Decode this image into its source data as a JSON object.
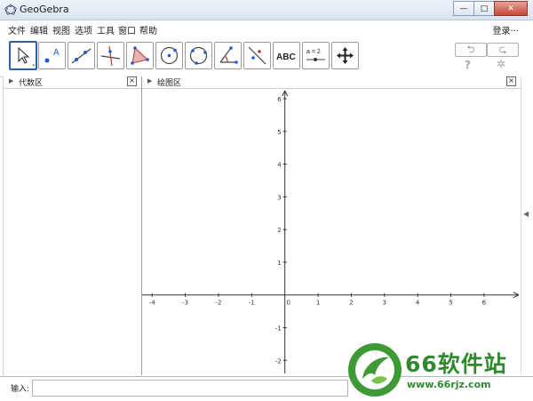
{
  "window": {
    "title": "GeoGebra",
    "minimize": "—",
    "maximize": "□",
    "close": "✕"
  },
  "menu": {
    "items": [
      "文件",
      "编辑",
      "视图",
      "选项",
      "工具",
      "窗口",
      "帮助"
    ],
    "login": "登录···"
  },
  "toolbar": {
    "tools": [
      {
        "name": "move-tool",
        "icon": "arrow-cursor-icon"
      },
      {
        "name": "point-tool",
        "icon": "point-A-icon",
        "label": "A"
      },
      {
        "name": "line-tool",
        "icon": "line-through-points-icon"
      },
      {
        "name": "perpendicular-tool",
        "icon": "perpendicular-line-icon"
      },
      {
        "name": "polygon-tool",
        "icon": "polygon-icon"
      },
      {
        "name": "circle-tool",
        "icon": "circle-center-point-icon"
      },
      {
        "name": "circle-three-points-tool",
        "icon": "circle-three-points-icon"
      },
      {
        "name": "angle-tool",
        "icon": "angle-icon"
      },
      {
        "name": "reflect-tool",
        "icon": "reflect-line-icon"
      },
      {
        "name": "text-tool",
        "icon": "text-abc-icon",
        "label": "ABC"
      },
      {
        "name": "slider-tool",
        "icon": "slider-icon",
        "label": "a = 2"
      },
      {
        "name": "move-graphics-tool",
        "icon": "move-view-icon"
      }
    ],
    "undo": "⮌",
    "redo": "⮎",
    "help": "?",
    "settings": "✲"
  },
  "panels": {
    "algebra": {
      "title": "代数区",
      "close": "×"
    },
    "graphics": {
      "title": "绘图区",
      "close": "×"
    }
  },
  "graphics_view": {
    "x_ticks": [
      "-4",
      "-3",
      "-2",
      "-1",
      "0",
      "1",
      "2",
      "3",
      "4",
      "5",
      "6"
    ],
    "y_ticks": [
      "6",
      "5",
      "4",
      "3",
      "2",
      "1",
      "-1",
      "-2"
    ],
    "x_range": [
      -4.3,
      7.1
    ],
    "y_range": [
      -2.4,
      6.3
    ]
  },
  "input_bar": {
    "label": "输入:",
    "value": "",
    "placeholder": ""
  },
  "watermark": {
    "text": "66软件站",
    "url": "www.66rjz.com"
  },
  "colors": {
    "accent": "#2d5fa6",
    "watermark_green": "#2f8a2f"
  }
}
